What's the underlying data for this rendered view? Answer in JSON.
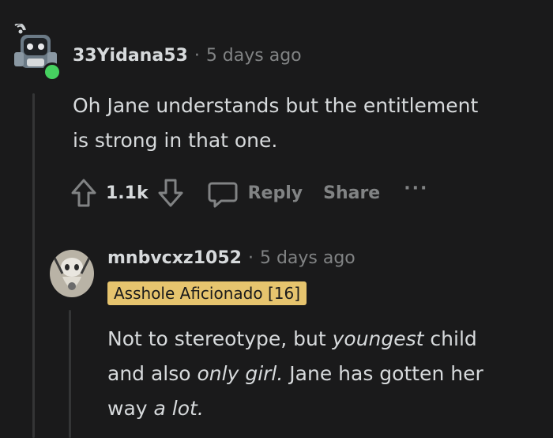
{
  "comments": [
    {
      "username": "33Yidana53",
      "separator": "·",
      "time": "5 days ago",
      "online": true,
      "body_line1": "Oh Jane understands but the entitlement",
      "body_line2": "is strong in that one.",
      "votes": "1.1k",
      "reply_label": "Reply",
      "share_label": "Share",
      "more_label": "···"
    },
    {
      "username": "mnbvcxz1052",
      "separator": "·",
      "time": "5 days ago",
      "flair": "Asshole Aficionado [16]",
      "body": {
        "l1_a": "Not to stereotype, but ",
        "l1_b": "youngest",
        "l1_c": " child",
        "l2_a": "and also ",
        "l2_b": "only girl.",
        "l2_c": " Jane has gotten her",
        "l3_a": "way ",
        "l3_b": "a lot."
      }
    }
  ],
  "colors": {
    "background": "#1a1a1b",
    "text": "#d7dadc",
    "muted": "#818384",
    "flair_bg": "#e6c46e",
    "online": "#46d160"
  },
  "icons": [
    "upvote-icon",
    "downvote-icon",
    "comment-icon",
    "more-icon"
  ]
}
